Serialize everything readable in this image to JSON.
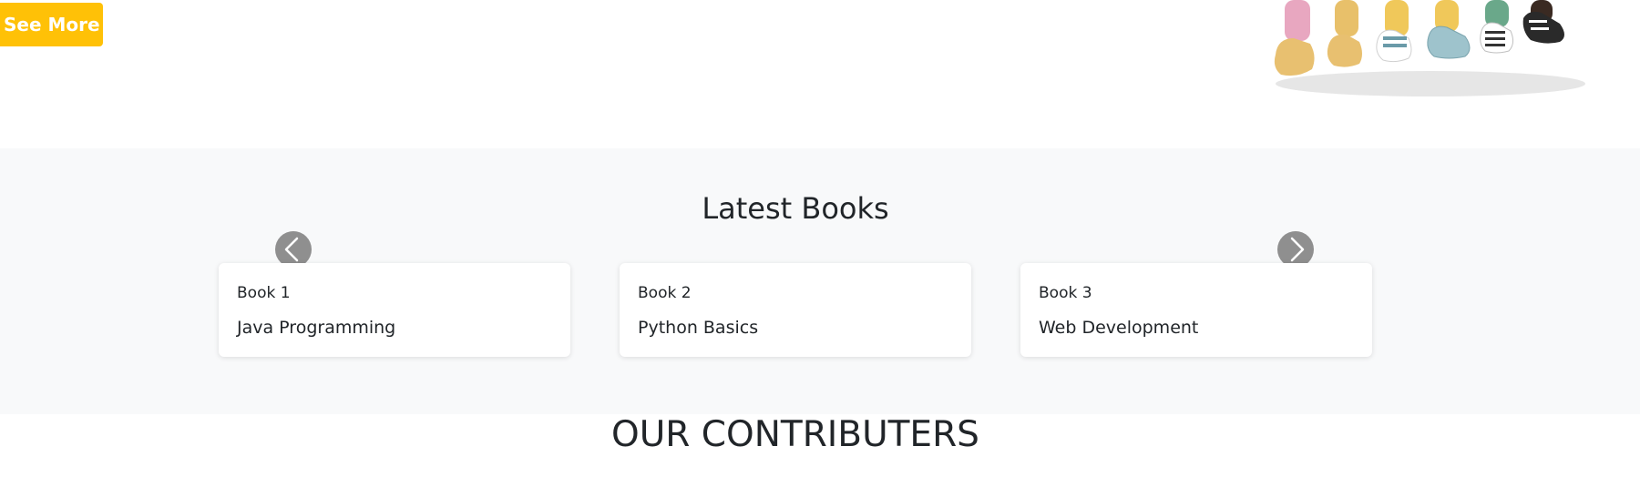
{
  "hero": {
    "see_more_label": "See More"
  },
  "latest_books": {
    "title": "Latest Books",
    "prev_icon": "chevron-left-icon",
    "next_icon": "chevron-right-icon",
    "books": [
      {
        "number": "Book 1",
        "title": "Java Programming"
      },
      {
        "number": "Book 2",
        "title": "Python Basics"
      },
      {
        "number": "Book 3",
        "title": "Web Development"
      }
    ]
  },
  "contributors": {
    "title": "OUR CONTRIBUTERS"
  },
  "colors": {
    "accent": "#ffc107",
    "section_bg": "#f8f9fa",
    "arrow_bg": "#8f8f8f"
  }
}
